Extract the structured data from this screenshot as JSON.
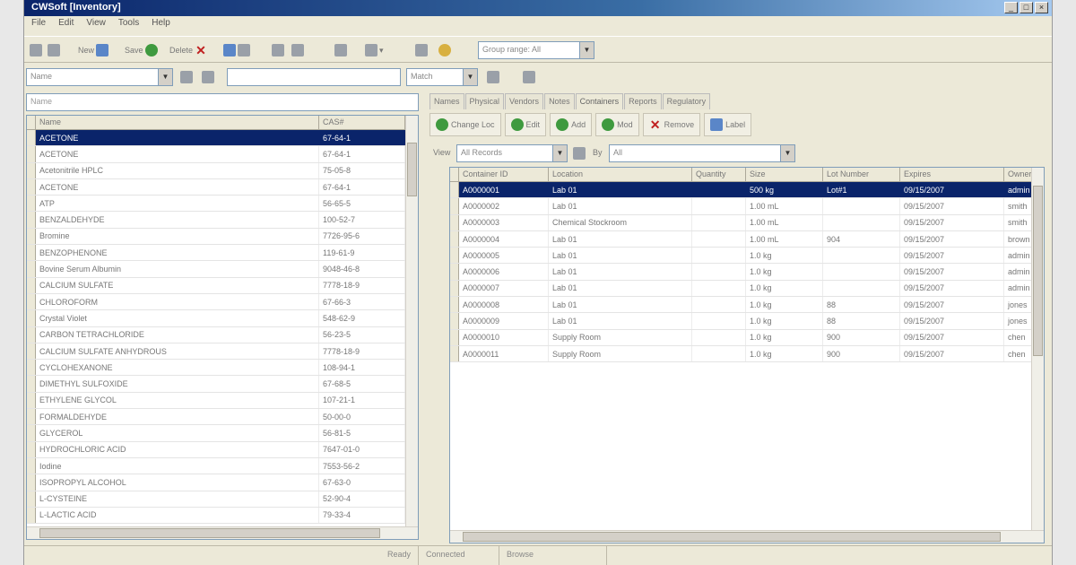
{
  "window": {
    "title": "CWSoft [Inventory]"
  },
  "menu": [
    "File",
    "Edit",
    "View",
    "Tools",
    "Help"
  ],
  "toolbar": {
    "new_label": "New",
    "save_label": "Save",
    "delete_label": "Delete",
    "view_combo": "Group range: All"
  },
  "search": {
    "field_value": "Name",
    "query_value": "",
    "target_value": "Match"
  },
  "left": {
    "filter_value": "Name",
    "columns": [
      "Name",
      "CAS#"
    ],
    "rows": [
      [
        "ACETONE",
        "67-64-1"
      ],
      [
        "ACETONE",
        "67-64-1"
      ],
      [
        "Acetonitrile HPLC",
        "75-05-8"
      ],
      [
        "ACETONE",
        "67-64-1"
      ],
      [
        "ATP",
        "56-65-5"
      ],
      [
        "BENZALDEHYDE",
        "100-52-7"
      ],
      [
        "Bromine",
        "7726-95-6"
      ],
      [
        "BENZOPHENONE",
        "119-61-9"
      ],
      [
        "Bovine Serum Albumin",
        "9048-46-8"
      ],
      [
        "CALCIUM SULFATE",
        "7778-18-9"
      ],
      [
        "CHLOROFORM",
        "67-66-3"
      ],
      [
        "Crystal Violet",
        "548-62-9"
      ],
      [
        "CARBON TETRACHLORIDE",
        "56-23-5"
      ],
      [
        "CALCIUM SULFATE ANHYDROUS",
        "7778-18-9"
      ],
      [
        "CYCLOHEXANONE",
        "108-94-1"
      ],
      [
        "DIMETHYL SULFOXIDE",
        "67-68-5"
      ],
      [
        "ETHYLENE GLYCOL",
        "107-21-1"
      ],
      [
        "FORMALDEHYDE",
        "50-00-0"
      ],
      [
        "GLYCEROL",
        "56-81-5"
      ],
      [
        "HYDROCHLORIC ACID",
        "7647-01-0"
      ],
      [
        "Iodine",
        "7553-56-2"
      ],
      [
        "ISOPROPYL ALCOHOL",
        "67-63-0"
      ],
      [
        "L-CYSTEINE",
        "52-90-4"
      ],
      [
        "L-LACTIC ACID",
        "79-33-4"
      ]
    ]
  },
  "right": {
    "tabs": [
      "Names",
      "Physical",
      "Vendors",
      "Notes",
      "Containers",
      "Reports",
      "Regulatory"
    ],
    "active_tab": "Containers",
    "actions": [
      "Change Loc",
      "Edit",
      "Add",
      "Mod",
      "Remove",
      "Label"
    ],
    "view_label": "View",
    "view_value": "All Records",
    "by_label": "By",
    "by_value": "All",
    "columns": [
      "Container ID",
      "Location",
      "Quantity",
      "Size",
      "Lot Number",
      "Expires",
      "Owner"
    ],
    "rows": [
      [
        "A0000001",
        "Lab 01",
        "",
        "500 kg",
        "Lot#1",
        "09/15/2007",
        "admin"
      ],
      [
        "A0000002",
        "Lab 01",
        "",
        "1.00 mL",
        "",
        "09/15/2007",
        "smith"
      ],
      [
        "A0000003",
        "Chemical Stockroom",
        "",
        "1.00 mL",
        "",
        "09/15/2007",
        "smith"
      ],
      [
        "A0000004",
        "Lab 01",
        "",
        "1.00 mL",
        "904",
        "09/15/2007",
        "brown"
      ],
      [
        "A0000005",
        "Lab 01",
        "",
        "1.0 kg",
        "",
        "09/15/2007",
        "admin"
      ],
      [
        "A0000006",
        "Lab 01",
        "",
        "1.0 kg",
        "",
        "09/15/2007",
        "admin"
      ],
      [
        "A0000007",
        "Lab 01",
        "",
        "1.0 kg",
        "",
        "09/15/2007",
        "admin"
      ],
      [
        "A0000008",
        "Lab 01",
        "",
        "1.0 kg",
        "88",
        "09/15/2007",
        "jones"
      ],
      [
        "A0000009",
        "Lab 01",
        "",
        "1.0 kg",
        "88",
        "09/15/2007",
        "jones"
      ],
      [
        "A0000010",
        "Supply Room",
        "",
        "1.0 kg",
        "900",
        "09/15/2007",
        "chen"
      ],
      [
        "A0000011",
        "Supply Room",
        "",
        "1.0 kg",
        "900",
        "09/15/2007",
        "chen"
      ]
    ]
  },
  "status": {
    "left": "Ready",
    "middle": "Connected",
    "right": "Browse"
  }
}
